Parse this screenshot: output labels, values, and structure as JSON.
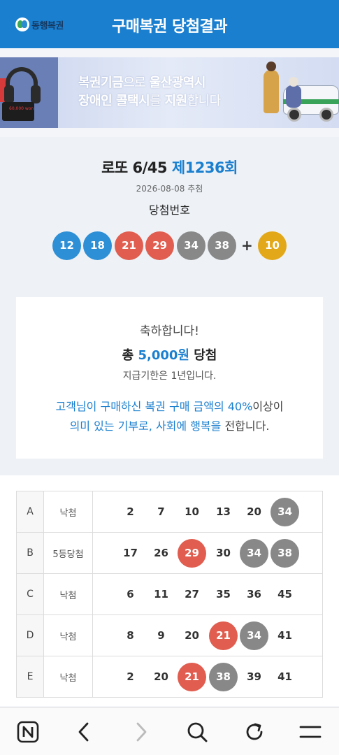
{
  "header": {
    "logo_text": "동행복권",
    "title": "구매복권 당첨결과"
  },
  "banner": {
    "line1_a": "복권기금",
    "line1_b": "으로 ",
    "line1_c": "울산광역시",
    "line2_a": "장애인 콜택시",
    "line2_b": "를 ",
    "line2_c": "지원",
    "line2_d": "합니다",
    "card_text": "60,000 won"
  },
  "result": {
    "game": "로또 6/45 ",
    "round": "제1236회",
    "draw_date": "2026-08-08 추첨",
    "win_label": "당첨번호",
    "winning_numbers": [
      {
        "value": "12",
        "color": "#2d8fd5"
      },
      {
        "value": "18",
        "color": "#2d8fd5"
      },
      {
        "value": "21",
        "color": "#e05d4f"
      },
      {
        "value": "29",
        "color": "#e05d4f"
      },
      {
        "value": "34",
        "color": "#888888"
      },
      {
        "value": "38",
        "color": "#888888"
      }
    ],
    "plus": "+",
    "bonus": {
      "value": "10",
      "color": "#e3a819"
    }
  },
  "congrats": {
    "hello": "축하합니다!",
    "prize_prefix": "총 ",
    "prize_amount": "5,000원",
    "prize_suffix": " 당첨",
    "limit": "지급기한은 1년입니다.",
    "msg1_a": "고객님이 구매하신 복권 구매 금액의 ",
    "msg1_b": "40%",
    "msg1_c": "이상이",
    "msg2_a": "의미 있는 기부로, 사회에 ",
    "msg2_b": "행복을",
    "msg2_c": " 전합니다."
  },
  "tickets": [
    {
      "set": "A",
      "result": "낙첨",
      "numbers": [
        {
          "v": "2",
          "hit": ""
        },
        {
          "v": "7",
          "hit": ""
        },
        {
          "v": "10",
          "hit": ""
        },
        {
          "v": "13",
          "hit": ""
        },
        {
          "v": "20",
          "hit": ""
        },
        {
          "v": "34",
          "hit": "gray"
        }
      ]
    },
    {
      "set": "B",
      "result": "5등당첨",
      "numbers": [
        {
          "v": "17",
          "hit": ""
        },
        {
          "v": "26",
          "hit": ""
        },
        {
          "v": "29",
          "hit": "red"
        },
        {
          "v": "30",
          "hit": ""
        },
        {
          "v": "34",
          "hit": "gray"
        },
        {
          "v": "38",
          "hit": "gray"
        }
      ]
    },
    {
      "set": "C",
      "result": "낙첨",
      "numbers": [
        {
          "v": "6",
          "hit": ""
        },
        {
          "v": "11",
          "hit": ""
        },
        {
          "v": "27",
          "hit": ""
        },
        {
          "v": "35",
          "hit": ""
        },
        {
          "v": "36",
          "hit": ""
        },
        {
          "v": "45",
          "hit": ""
        }
      ]
    },
    {
      "set": "D",
      "result": "낙첨",
      "numbers": [
        {
          "v": "8",
          "hit": ""
        },
        {
          "v": "9",
          "hit": ""
        },
        {
          "v": "20",
          "hit": ""
        },
        {
          "v": "21",
          "hit": "red"
        },
        {
          "v": "34",
          "hit": "gray"
        },
        {
          "v": "41",
          "hit": ""
        }
      ]
    },
    {
      "set": "E",
      "result": "낙첨",
      "numbers": [
        {
          "v": "2",
          "hit": ""
        },
        {
          "v": "20",
          "hit": ""
        },
        {
          "v": "21",
          "hit": "red"
        },
        {
          "v": "38",
          "hit": "gray"
        },
        {
          "v": "39",
          "hit": ""
        },
        {
          "v": "41",
          "hit": ""
        }
      ]
    }
  ],
  "navbar": {
    "icons": [
      "naver-home-icon",
      "back-icon",
      "forward-icon",
      "search-icon",
      "refresh-icon",
      "menu-icon"
    ]
  }
}
